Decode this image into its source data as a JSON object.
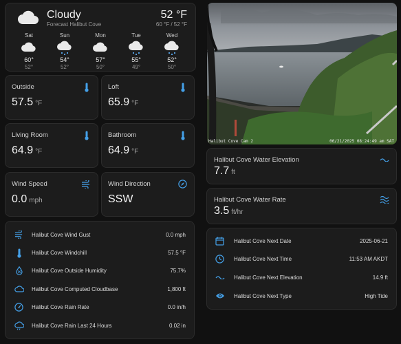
{
  "weather": {
    "condition": "Cloudy",
    "source": "Forecast Halibut Cove",
    "temperature": "52 °F",
    "high_low": "60 °F / 52 °F",
    "forecast": [
      {
        "day": "Sat",
        "high": "60°",
        "low": "52°",
        "icon": "cloudy-icon"
      },
      {
        "day": "Sun",
        "high": "54°",
        "low": "52°",
        "icon": "rainy-icon"
      },
      {
        "day": "Mon",
        "high": "57°",
        "low": "50°",
        "icon": "cloudy-icon"
      },
      {
        "day": "Tue",
        "high": "55°",
        "low": "49°",
        "icon": "rainy-icon"
      },
      {
        "day": "Wed",
        "high": "52°",
        "low": "50°",
        "icon": "rainy-icon"
      }
    ]
  },
  "tiles": {
    "outside": {
      "label": "Outside",
      "value": "57.5",
      "unit": "°F",
      "icon": "thermometer-icon"
    },
    "loft": {
      "label": "Loft",
      "value": "65.9",
      "unit": "°F",
      "icon": "thermometer-icon"
    },
    "living_room": {
      "label": "Living Room",
      "value": "64.9",
      "unit": "°F",
      "icon": "thermometer-icon"
    },
    "bathroom": {
      "label": "Bathroom",
      "value": "64.9",
      "unit": "°F",
      "icon": "thermometer-icon"
    },
    "wind_speed": {
      "label": "Wind Speed",
      "value": "0.0",
      "unit": "mph",
      "icon": "wind-icon"
    },
    "wind_direction": {
      "label": "Wind Direction",
      "value": "SSW",
      "icon": "compass-icon"
    }
  },
  "sensors": [
    {
      "label": "Halibut Cove Wind Gust",
      "value": "0.0 mph",
      "icon": "wind-icon"
    },
    {
      "label": "Halibut Cove Windchill",
      "value": "57.5 °F",
      "icon": "thermometer-icon"
    },
    {
      "label": "Halibut Cove Outside Humidity",
      "value": "75.7%",
      "icon": "water-percent-icon"
    },
    {
      "label": "Halibut Cove Computed Cloudbase",
      "value": "1,800 ft",
      "icon": "cloud-outline-icon"
    },
    {
      "label": "Halibut Cove Rain Rate",
      "value": "0.0 in/h",
      "icon": "gauge-icon"
    },
    {
      "label": "Halibut Cove Rain Last 24 Hours",
      "value": "0.02 in",
      "icon": "cloud-rain-icon"
    }
  ],
  "camera": {
    "label": "Halibut Cove Cam 2",
    "timestamp": "06/21/2025 08:24:49 am SAT"
  },
  "water": {
    "elevation": {
      "label": "Halibut Cove Water Elevation",
      "value": "7.7",
      "unit": "ft",
      "icon": "wave-icon"
    },
    "rate": {
      "label": "Halibut Cove Water Rate",
      "value": "3.5",
      "unit": "ft/hr",
      "icon": "waves-icon"
    }
  },
  "tides": [
    {
      "label": "Halibut Cove Next Date",
      "value": "2025-06-21",
      "icon": "calendar-icon"
    },
    {
      "label": "Halibut Cove Next Time",
      "value": "11:53 AM AKDT",
      "icon": "clock-icon"
    },
    {
      "label": "Halibut Cove Next Elevation",
      "value": "14.9 ft",
      "icon": "wave-icon"
    },
    {
      "label": "Halibut Cove Next Type",
      "value": "High Tide",
      "icon": "eye-icon"
    }
  ],
  "colors": {
    "accent": "#44a0e8",
    "card": "#1c1c1c",
    "background": "#111111"
  }
}
